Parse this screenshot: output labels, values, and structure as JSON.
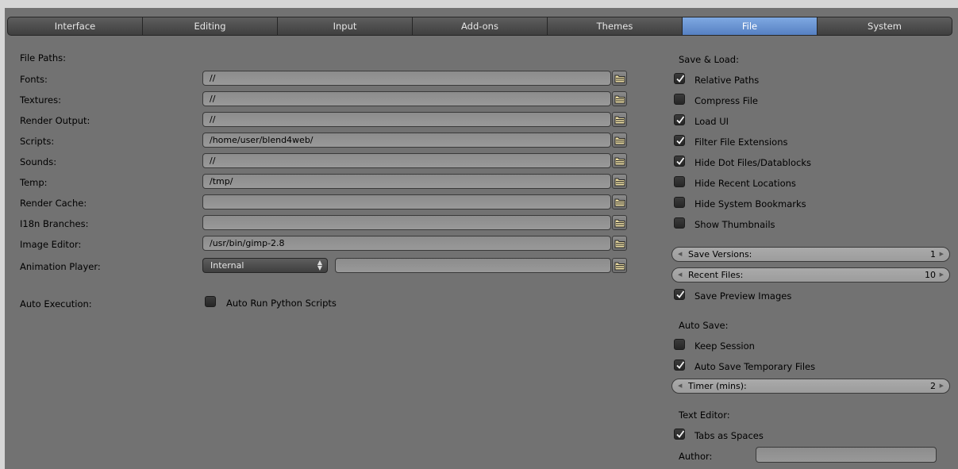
{
  "tabs": [
    {
      "label": "Interface"
    },
    {
      "label": "Editing"
    },
    {
      "label": "Input"
    },
    {
      "label": "Add-ons"
    },
    {
      "label": "Themes"
    },
    {
      "label": "File",
      "active": true
    },
    {
      "label": "System"
    }
  ],
  "file_paths": {
    "heading": "File Paths:",
    "rows": [
      {
        "label": "Fonts:",
        "value": "//"
      },
      {
        "label": "Textures:",
        "value": "//"
      },
      {
        "label": "Render Output:",
        "value": "//"
      },
      {
        "label": "Scripts:",
        "value": "/home/user/blend4web/"
      },
      {
        "label": "Sounds:",
        "value": "//"
      },
      {
        "label": "Temp:",
        "value": "/tmp/"
      },
      {
        "label": "Render Cache:",
        "value": ""
      },
      {
        "label": "I18n Branches:",
        "value": ""
      },
      {
        "label": "Image Editor:",
        "value": "/usr/bin/gimp-2.8"
      }
    ],
    "animation_player": {
      "label": "Animation Player:",
      "dropdown": "Internal",
      "value": ""
    }
  },
  "auto_execution": {
    "label": "Auto Execution:",
    "checkbox_label": "Auto Run Python Scripts",
    "checked": false
  },
  "save_load": {
    "heading": "Save & Load:",
    "options": [
      {
        "label": "Relative Paths",
        "checked": true
      },
      {
        "label": "Compress File",
        "checked": false
      },
      {
        "label": "Load UI",
        "checked": true
      },
      {
        "label": "Filter File Extensions",
        "checked": true
      },
      {
        "label": "Hide Dot Files/Datablocks",
        "checked": true
      },
      {
        "label": "Hide Recent Locations",
        "checked": false
      },
      {
        "label": "Hide System Bookmarks",
        "checked": false
      },
      {
        "label": "Show Thumbnails",
        "checked": false
      }
    ],
    "save_versions": {
      "label": "Save Versions:",
      "value": "1"
    },
    "recent_files": {
      "label": "Recent Files:",
      "value": "10"
    },
    "save_preview": {
      "label": "Save Preview Images",
      "checked": true
    }
  },
  "auto_save": {
    "heading": "Auto Save:",
    "keep_session": {
      "label": "Keep Session",
      "checked": false
    },
    "auto_save_temp": {
      "label": "Auto Save Temporary Files",
      "checked": true
    },
    "timer": {
      "label": "Timer (mins):",
      "value": "2"
    }
  },
  "text_editor": {
    "heading": "Text Editor:",
    "tabs_as_spaces": {
      "label": "Tabs as Spaces",
      "checked": true
    },
    "author": {
      "label": "Author:",
      "value": ""
    }
  }
}
